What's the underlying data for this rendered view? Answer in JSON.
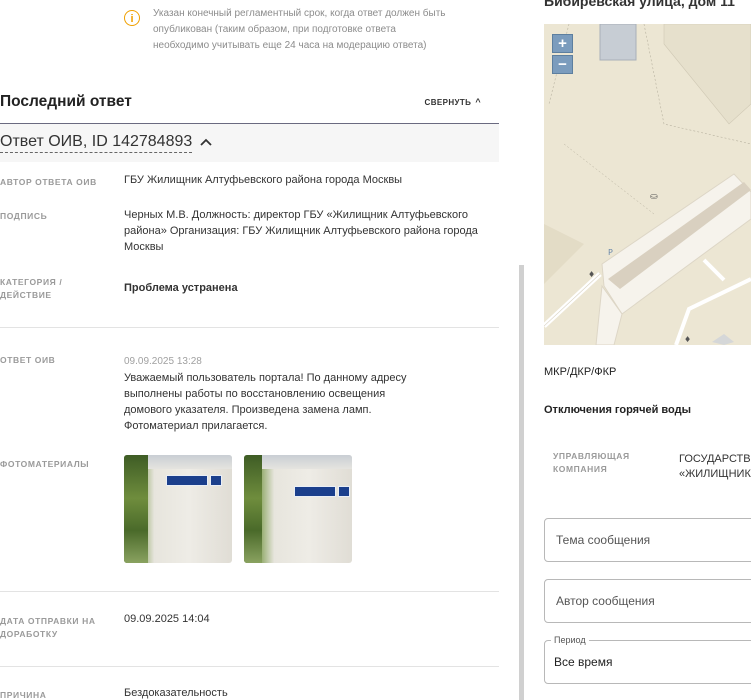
{
  "notice": {
    "text": "Указан конечный регламентный срок, когда ответ должен быть опубликован (таким образом, при подготовке ответа необходимо учитывать еще 24 часа на модерацию ответа)"
  },
  "last_answer": {
    "title": "Последний ответ",
    "collapse_label": "СВЕРНУТЬ",
    "answer_title": "Ответ ОИВ, ID 142784893"
  },
  "fields": {
    "author_label": "АВТОР ОТВЕТА ОИВ",
    "author_value": "ГБУ Жилищник Алтуфьевского района города Москвы",
    "signature_label": "ПОДПИСЬ",
    "signature_value": "Черных М.В. Должность: директор ГБУ «Жилищник Алтуфьевского района» Организация: ГБУ Жилищник Алтуфьевского района города Москвы",
    "category_label": "КАТЕГОРИЯ / ДЕЙСТВИЕ",
    "category_value": "Проблема устранена",
    "response_label": "ОТВЕТ ОИВ",
    "response_date": "09.09.2025 13:28",
    "response_text": "Уважаемый пользователь портала! По данному адресу выполнены работы по восстановлению освещения домового указателя. Произведена замена ламп. Фотоматериал прилагается.",
    "photos_label": "ФОТОМАТЕРИАЛЫ",
    "sent_label": "ДАТА ОТПРАВКИ НА ДОРАБОТКУ",
    "sent_value": "09.09.2025 14:04",
    "reason_label": "ПРИЧИНА ОТПРАВКИ",
    "reason_value": "Бездоказательность"
  },
  "right": {
    "address": "Бибиревская улица, дом 11",
    "zoom_in": "+",
    "zoom_out": "−",
    "mkr_label": "МКР/ДКР/ФКР",
    "hot_water_label": "Отключения горячей воды",
    "company_label": "УПРАВЛЯЮЩАЯ КОМПАНИЯ",
    "company_value_1": "ГОСУДАРСТВЕ",
    "company_value_2": "«ЖИЛИЩНИК",
    "subject_placeholder": "Тема сообщения",
    "author_placeholder": "Автор сообщения",
    "period_legend": "Период",
    "period_value": "Все время"
  },
  "colors": {
    "notice_icon": "#f0a000",
    "map_background": "#ece6d3",
    "map_zoom": "#7b9cbd"
  }
}
